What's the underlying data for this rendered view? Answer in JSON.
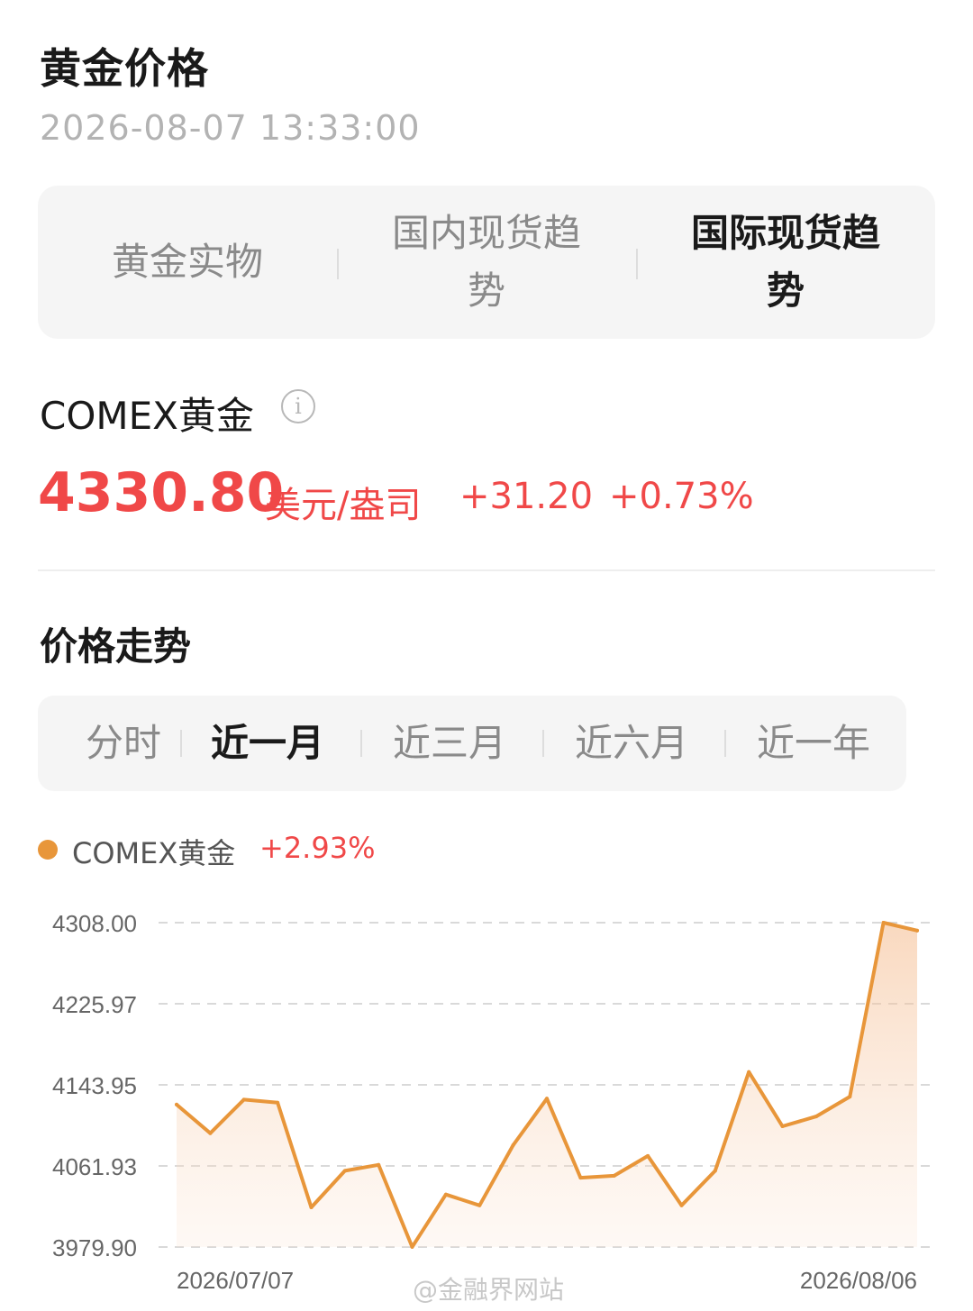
{
  "header": {
    "title": "黄金价格",
    "timestamp": "2026-08-07 13:33:00"
  },
  "tabs": [
    {
      "label": "黄金实物",
      "active": false
    },
    {
      "label": "国内现货趋势",
      "active": false
    },
    {
      "label": "国际现货趋势",
      "active": true
    }
  ],
  "quote": {
    "name": "COMEX黄金",
    "info_icon": "info-icon",
    "price": "4330.80",
    "unit": "美元/盎司",
    "change": "+31.20",
    "change_pct": "+0.73%",
    "up_color": "#f04848"
  },
  "trend": {
    "title": "价格走势",
    "ranges": [
      {
        "label": "分时",
        "active": false
      },
      {
        "label": "近一月",
        "active": true
      },
      {
        "label": "近三月",
        "active": false
      },
      {
        "label": "近六月",
        "active": false
      },
      {
        "label": "近一年",
        "active": false
      }
    ]
  },
  "chart_data": {
    "type": "area",
    "title": "",
    "xlabel": "",
    "ylabel": "",
    "legend": {
      "position": "top-left"
    },
    "grid": true,
    "line_color": "#e8963a",
    "series": [
      {
        "name": "COMEX黄金",
        "change": "+2.93%",
        "values": [
          4124,
          4095,
          4129,
          4126,
          4020,
          4057,
          4063,
          3980,
          4033,
          4022,
          4083,
          4130,
          4050,
          4052,
          4072,
          4022,
          4057,
          4157,
          4102,
          4112,
          4132,
          4308,
          4300
        ]
      }
    ],
    "yticks": [
      "4308.00",
      "4225.97",
      "4143.95",
      "4061.93",
      "3979.90"
    ],
    "ylim": [
      3979.9,
      4308.0
    ],
    "x_start_label": "2026/07/07",
    "x_end_label": "2026/08/06"
  },
  "watermark": "@金融界网站"
}
